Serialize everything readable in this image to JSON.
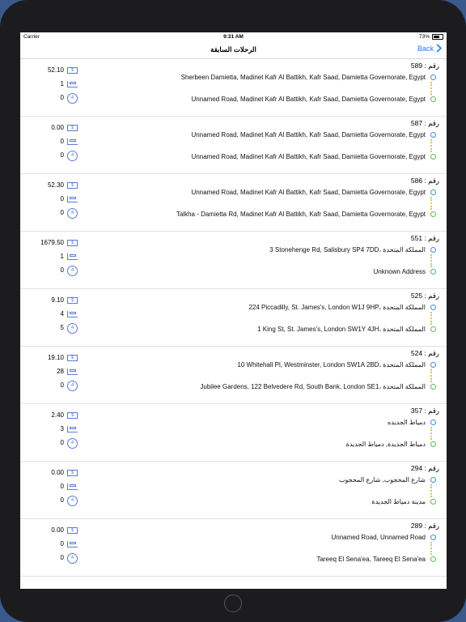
{
  "status": {
    "carrier": "Carrier",
    "time": "9:31 AM",
    "battery": "73%"
  },
  "nav": {
    "title": "الرحلات السابقة",
    "back": "Back"
  },
  "trips": [
    {
      "number": "رقم : 589",
      "from": "Sherbeen Damietta, Madinet Kafr Al Battikh, Kafr Saad, Damietta Governorate, Egypt",
      "to": "Unnamed Road, Madinet Kafr Al Battikh, Kafr Saad, Damietta Governorate, Egypt",
      "price": "52.10",
      "seats": "1",
      "time": "0"
    },
    {
      "number": "رقم : 587",
      "from": "Unnamed Road, Madinet Kafr Al Battikh, Kafr Saad, Damietta Governorate, Egypt",
      "to": "Unnamed Road, Madinet Kafr Al Battikh, Kafr Saad, Damietta Governorate, Egypt",
      "price": "0.00",
      "seats": "0",
      "time": "0"
    },
    {
      "number": "رقم : 586",
      "from": "Unnamed Road, Madinet Kafr Al Battikh, Kafr Saad, Damietta Governorate, Egypt",
      "to": "Talkha - Damietta Rd, Madinet Kafr Al Battikh, Kafr Saad, Damietta Governorate, Egypt",
      "price": "52.30",
      "seats": "0",
      "time": "0"
    },
    {
      "number": "رقم : 551",
      "from": "3 Stonehenge Rd, Salisbury SP4 7DD، المملكة المتحدة",
      "to": "Unknown Address",
      "price": "1679.50",
      "seats": "1",
      "time": "0"
    },
    {
      "number": "رقم : 525",
      "from": "224 Piccadilly, St. James's, London W1J 9HP، المملكة المتحدة",
      "to": "1 King St, St. James's, London SW1Y 4JH، المملكة المتحدة",
      "price": "9.10",
      "seats": "4",
      "time": "5"
    },
    {
      "number": "رقم : 524",
      "from": "10 Whitehall Pl, Westminster, London SW1A 2BD، المملكة المتحدة",
      "to": "Jubilee Gardens, 122 Belvedere Rd, South Bank, London SE1، المملكة المتحدة",
      "price": "19.10",
      "seats": "28",
      "time": "0"
    },
    {
      "number": "رقم : 357",
      "from": "دمياط الجديده",
      "to": "دمياط الجديدة, دمياط الجديدة",
      "price": "2.40",
      "seats": "3",
      "time": "0"
    },
    {
      "number": "رقم : 294",
      "from": "شارع المحجوب, شارع المحجوب",
      "to": "مدينة دمياط الجديدة",
      "price": "0.00",
      "seats": "0",
      "time": "0"
    },
    {
      "number": "رقم : 289",
      "from": "Unnamed Road, Unnamed Road",
      "to": "Tareeq El Sena'ea, Tareeq El Sena'ea",
      "price": "0.00",
      "seats": "0",
      "time": "0"
    }
  ],
  "icons": {
    "money": "money-icon",
    "seats": "bed-icon",
    "time": "clock-icon"
  }
}
